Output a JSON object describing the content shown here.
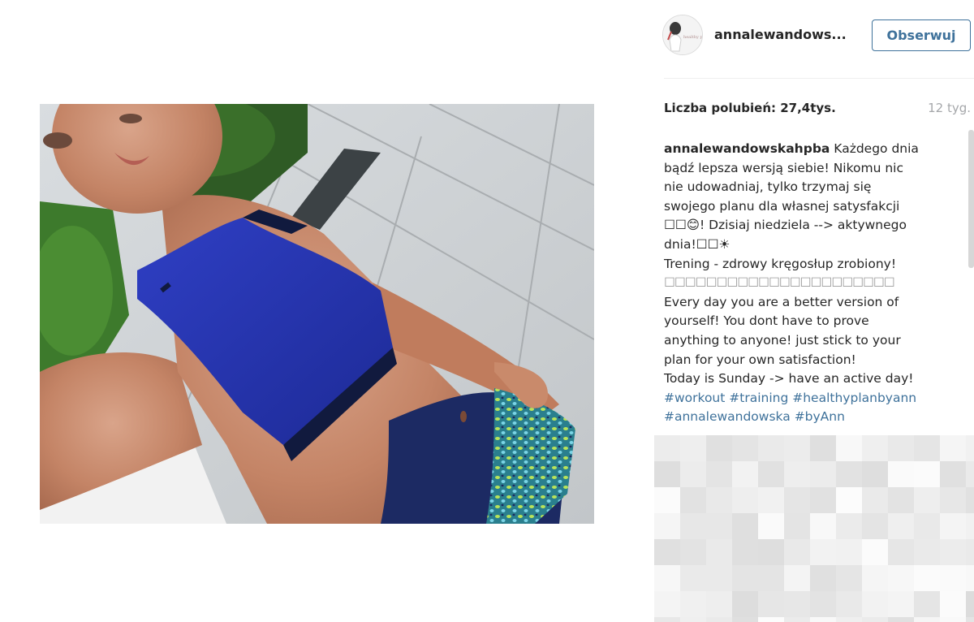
{
  "post": {
    "username": "annalewandows...",
    "follow_label": "Obserwuj",
    "likes_text": "Liczba polubień: 27,4tys.",
    "age_text": "12 tyg."
  },
  "caption": {
    "author": "annalewandowskahpba",
    "lines": [
      " Każdego dnia",
      "bądź lepsza wersją siebie! Nikomu nic",
      "nie udowadniaj, tylko trzymaj się",
      "swojego planu dla własnej satysfakcji",
      "☐☐😊! Dzisiaj niedziela --> aktywnego",
      "dnia!☐☐☀",
      "Trening - zdrowy kręgosłup zrobiony!",
      "☐☐☐☐☐☐☐☐☐☐☐☐☐☐☐☐☐☐☐☐☐☐",
      "Every day you are a better version of",
      "yourself! You dont have to prove",
      "anything to anyone! just stick to your",
      "plan for your own satisfaction!",
      "Today is Sunday -> have an active day!"
    ],
    "hashtags": [
      "#workout",
      "#training",
      "#healthyplanbyann",
      "#annalewandowska",
      "#byAnn"
    ]
  },
  "icons": {
    "avatar": "profile-avatar-icon"
  },
  "colors": {
    "link": "#3f729b",
    "text": "#262626",
    "muted": "#a5a7aa",
    "divider": "#efefef"
  }
}
